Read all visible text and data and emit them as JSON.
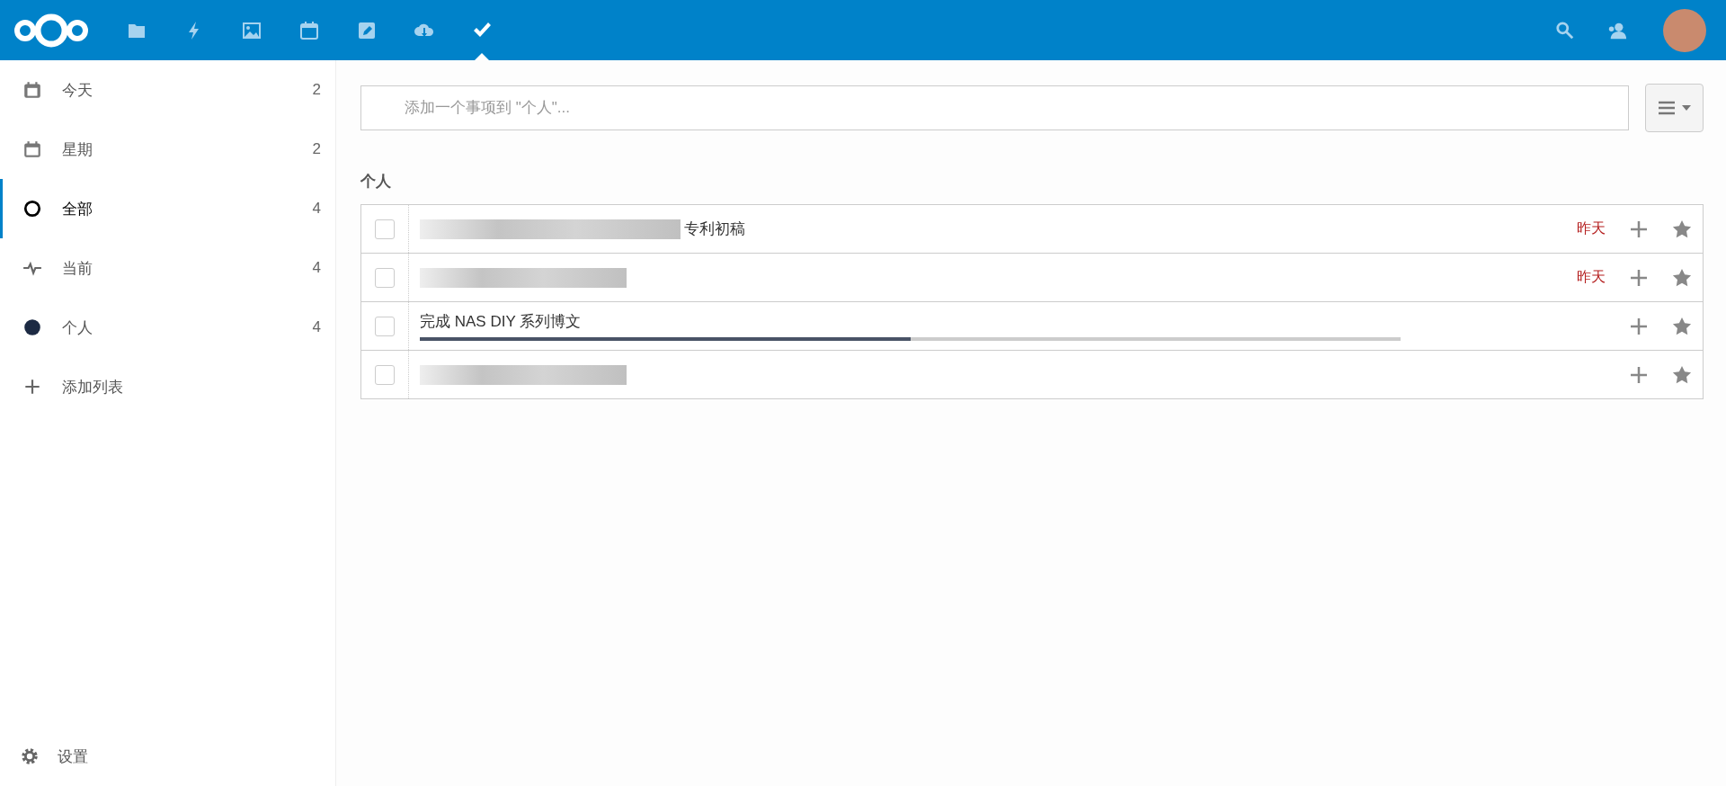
{
  "header": {
    "apps": [
      {
        "kind": "files",
        "selected": false
      },
      {
        "kind": "activity",
        "selected": false
      },
      {
        "kind": "gallery",
        "selected": false
      },
      {
        "kind": "calendar",
        "selected": false
      },
      {
        "kind": "notes",
        "selected": false
      },
      {
        "kind": "download",
        "selected": false
      },
      {
        "kind": "tasks",
        "selected": true
      }
    ]
  },
  "sidebar": {
    "items": [
      {
        "kind": "today",
        "label": "今天",
        "count": "2",
        "selected": false
      },
      {
        "kind": "week",
        "label": "星期",
        "count": "2",
        "selected": false
      },
      {
        "kind": "all",
        "label": "全部",
        "count": "4",
        "selected": true
      },
      {
        "kind": "current",
        "label": "当前",
        "count": "4",
        "selected": false
      },
      {
        "kind": "list",
        "label": "个人",
        "count": "4",
        "selected": false,
        "color": "#1c2a43"
      },
      {
        "kind": "add",
        "label": "添加列表",
        "selected": false
      }
    ],
    "settings": "设置"
  },
  "add_task": {
    "placeholder": "添加一个事项到 \"个人\"..."
  },
  "list_title": "个人",
  "tasks": [
    {
      "checked": false,
      "blurred": true,
      "title": "专利初稿",
      "due": "昨天"
    },
    {
      "checked": false,
      "blurred": true,
      "due": "昨天"
    },
    {
      "checked": false,
      "blurred": false,
      "title": "完成 NAS DIY 系列博文",
      "level": 0.5
    },
    {
      "checked": false,
      "blurred": true
    }
  ]
}
